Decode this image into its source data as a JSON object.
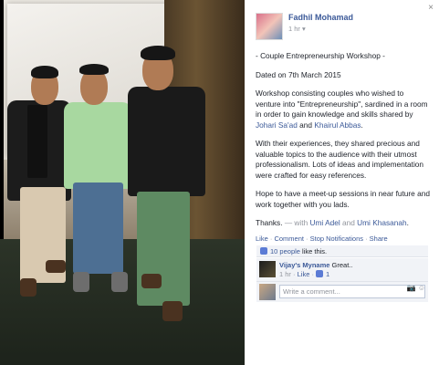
{
  "post": {
    "author": "Fadhil Mohamad",
    "time": "1 hr",
    "title": "- Couple Entrepreneurship Workshop -",
    "dated": "Dated on 7th March 2015",
    "para1_text": "Workshop consisting couples who wished to venture into \"Entrepreneurship\", sardined in a room in order to gain knowledge and skills shared by ",
    "para1_link1": "Johari Sa'ad",
    "para1_and": " and ",
    "para1_link2": "Khairul Abbas",
    "para1_end": ".",
    "para2": "With their experiences, they shared precious and valuable topics to the audience with their utmost professionalism. Lots of ideas and implementation were crafted for easy references.",
    "para3": "Hope to have a meet-up sessions in near future and work together with you lads.",
    "thanks": "Thanks.",
    "with_prefix": " — with ",
    "with1": "Umi Adel",
    "with_and": " and ",
    "with2": "Umi Khasanah",
    "with_end": "."
  },
  "actions": {
    "like": "Like",
    "comment": "Comment",
    "stop": "Stop Notifications",
    "share": "Share",
    "sep": " · "
  },
  "likes": {
    "count_link": "10 people",
    "suffix": " like this."
  },
  "comment": {
    "author": "Vijay's Myname",
    "text": " Great..",
    "time": "1 hr",
    "like": "Like",
    "like_count": "1"
  },
  "write_comment": {
    "placeholder": "Write a comment..."
  },
  "icons": {
    "close": "×",
    "camera": "📷",
    "smile": "☺"
  }
}
